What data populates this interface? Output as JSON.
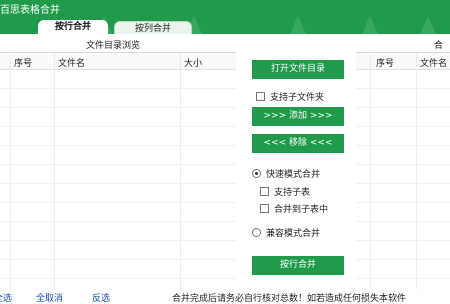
{
  "app": {
    "title": "百思表格合并"
  },
  "tabs": [
    {
      "label": "按行合并"
    },
    {
      "label": "按列合并"
    }
  ],
  "left_panel": {
    "title": "文件目录浏览",
    "columns": [
      "序号",
      "文件名",
      "大小"
    ]
  },
  "right_panel": {
    "title_partial": "合",
    "columns": [
      "序号",
      "文件名"
    ]
  },
  "actions": {
    "open_dir": "打开文件目录",
    "support_subfolders": "支持子文件夹",
    "add": ">>> 添加 >>>",
    "remove": "<<< 移除 <<<",
    "fast_mode": "快速模式合并",
    "support_subsheets": "支持子表",
    "merge_to_subsheet": "合并到子表中",
    "compat_mode": "兼容模式合并",
    "merge_rows": "按行合并"
  },
  "bottom": {
    "select_all": "全选",
    "deselect_all": "全取消",
    "invert": "反选",
    "notice": "合并完成后请务必自行核对总数！如若造成任何损失本软件"
  },
  "colors": {
    "accent": "#1f9b4b"
  }
}
